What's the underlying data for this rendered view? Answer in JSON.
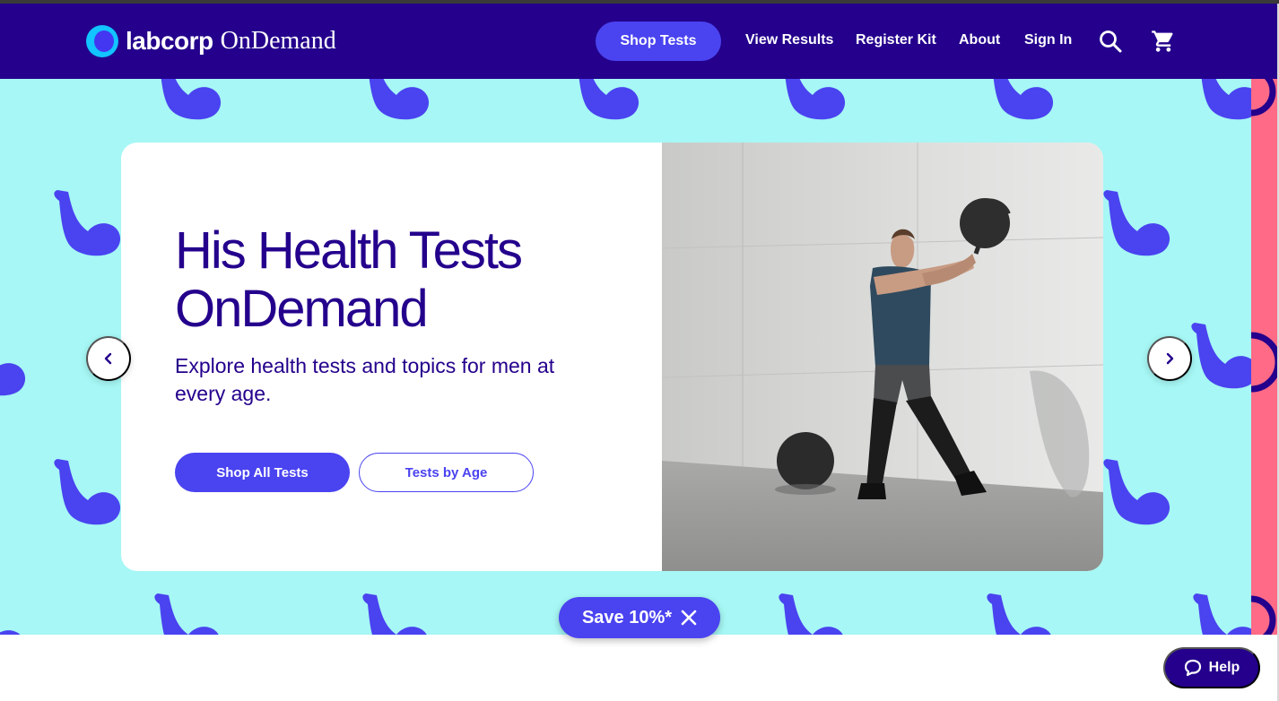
{
  "header": {
    "logo_brand": "labcorp",
    "logo_product": "OnDemand",
    "nav": {
      "shop_tests": "Shop Tests",
      "view_results": "View Results",
      "register_kit": "Register Kit",
      "about": "About",
      "sign_in": "Sign In"
    },
    "icons": {
      "search": "search-icon",
      "cart": "cart-icon"
    }
  },
  "hero": {
    "title": "His Health Tests OnDemand",
    "subtitle": "Explore health tests and topics for men at every age.",
    "primary_button": "Shop All Tests",
    "secondary_button": "Tests by Age",
    "prev_icon": "chevron-left-icon",
    "next_icon": "chevron-right-icon"
  },
  "promo": {
    "label": "Save 10%*",
    "close_icon": "close-icon"
  },
  "help": {
    "label": "Help",
    "icon": "chat-icon"
  },
  "colors": {
    "header_bg": "#24008c",
    "accent": "#4a43f0",
    "hero_bg": "#a6f7f5",
    "side_stripe": "#ff6a86",
    "logo_cyan": "#12c4ff"
  }
}
